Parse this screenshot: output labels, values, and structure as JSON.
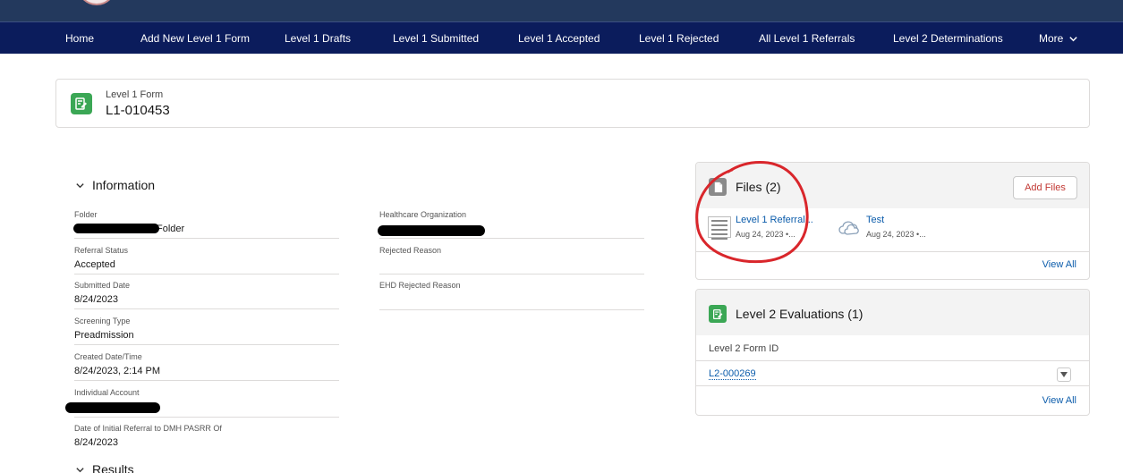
{
  "nav": {
    "items": [
      {
        "label": "Home"
      },
      {
        "label": "Add New Level 1 Form"
      },
      {
        "label": "Level 1 Drafts"
      },
      {
        "label": "Level 1 Submitted"
      },
      {
        "label": "Level 1 Accepted"
      },
      {
        "label": "Level 1 Rejected"
      },
      {
        "label": "All Level 1 Referrals"
      },
      {
        "label": "Level 2 Determinations"
      }
    ],
    "more_label": "More"
  },
  "record": {
    "type_label": "Level 1 Form",
    "name": "L1-010453"
  },
  "information": {
    "title": "Information",
    "left_fields": [
      {
        "label": "Folder",
        "value": "Folder"
      },
      {
        "label": "Referral Status",
        "value": "Accepted"
      },
      {
        "label": "Submitted Date",
        "value": "8/24/2023"
      },
      {
        "label": "Screening Type",
        "value": "Preadmission"
      },
      {
        "label": "Created Date/Time",
        "value": "8/24/2023, 2:14 PM"
      },
      {
        "label": "Individual Account",
        "value": ""
      },
      {
        "label": "Date of Initial Referral to DMH PASRR Of",
        "value": "8/24/2023"
      }
    ],
    "right_fields": [
      {
        "label": "Healthcare Organization",
        "value": ""
      },
      {
        "label": "Rejected Reason",
        "value": ""
      },
      {
        "label": "EHD Rejected Reason",
        "value": ""
      }
    ]
  },
  "results": {
    "title": "Results"
  },
  "files": {
    "title": "Files (2)",
    "add_label": "Add Files",
    "items": [
      {
        "name": "Level 1 Referral...",
        "meta": "Aug 24, 2023 •..."
      },
      {
        "name": "Test",
        "meta": "Aug 24, 2023 •..."
      }
    ],
    "view_all": "View All"
  },
  "evaluations": {
    "title": "Level 2 Evaluations (1)",
    "column": "Level 2 Form ID",
    "rows": [
      {
        "id": "L2-000269"
      }
    ],
    "view_all": "View All"
  },
  "colors": {
    "nav_bg": "#0b1c5c",
    "top_strip": "#23395d",
    "record_icon": "#3ba755",
    "link": "#0b5cab",
    "add_button_text": "#c23934",
    "annotation": "#d9262b"
  },
  "icons": [
    "chevron-down-icon",
    "record-form-icon",
    "files-icon",
    "evaluation-icon",
    "cloud-file-icon",
    "dropdown-arrow-icon"
  ]
}
